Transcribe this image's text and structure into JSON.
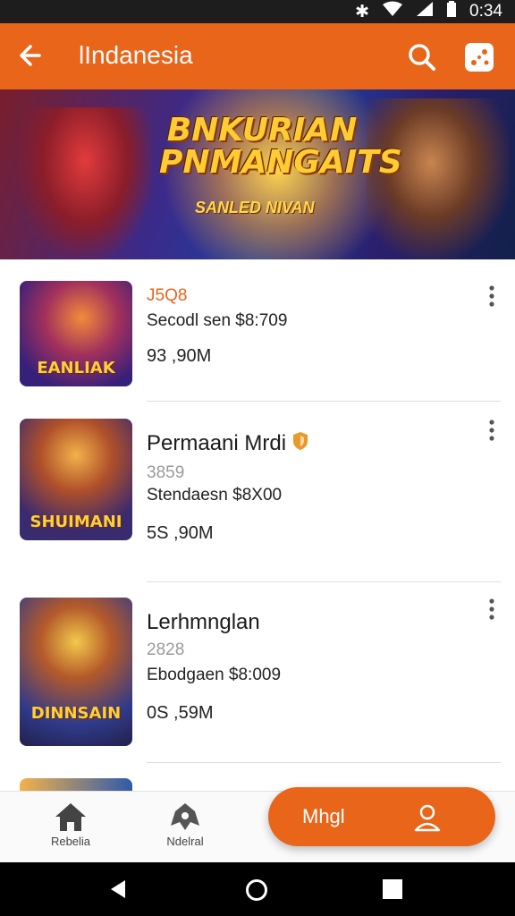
{
  "status_bar": {
    "time": "0:34"
  },
  "app_bar": {
    "title": "lIndanesia"
  },
  "banner": {
    "headline": "BNKURIAN PNMANGAITS",
    "subtitle": "SANLED NIVAN"
  },
  "items": [
    {
      "thumb_label": "EANLIAK",
      "title": "",
      "code": "J5Q8",
      "size": "Secodl sen $8:709",
      "downloads": "93 ,90M"
    },
    {
      "thumb_label": "SHUIMANI",
      "title": "Permaani Mrdi",
      "code": "3859",
      "size": "Stendaesn $8X00",
      "downloads": "5S ,90M"
    },
    {
      "thumb_label": "DINNSAIN",
      "title": "Lerhmnglan",
      "code": "2828",
      "size": "Ebodgaen $8:009",
      "downloads": "0S ,59M"
    }
  ],
  "bottom_nav": {
    "item1_label": "Rebelia",
    "item2_label": "Ndelral"
  },
  "fab": {
    "label": "Mhgl"
  },
  "colors": {
    "accent": "#e8651a"
  }
}
